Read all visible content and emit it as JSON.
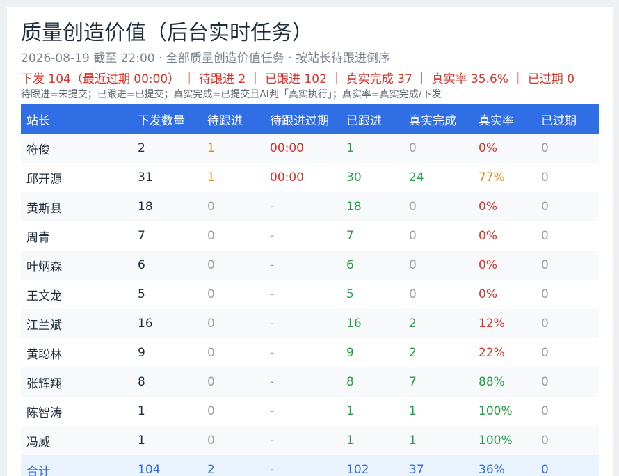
{
  "header": {
    "title": "质量创造价值（后台实时任务）",
    "subtitle": "2026-08-19 截至 22:00 · 全部质量创造价值任务 · 按站长待跟进倒序",
    "summary": "下发 104（最近过期 00:00） ｜ 待跟进 2 ｜ 已跟进 102 ｜ 真实完成 37 ｜ 真实率 35.6% ｜ 已过期 0",
    "note": "待跟进=未提交；已跟进=已提交；真实完成=已提交且AI判「真实执行」；真实率=真实完成/下发"
  },
  "table": {
    "columns": [
      "站长",
      "下发数量",
      "待跟进",
      "待跟进过期",
      "已跟进",
      "真实完成",
      "真实率",
      "已过期"
    ],
    "rows": [
      {
        "name": "符俊",
        "issued": "2",
        "pending": "1",
        "pending_expire": "00:00",
        "followed": "1",
        "real_done": "0",
        "real_rate": "0%",
        "expired": "0"
      },
      {
        "name": "邱开源",
        "issued": "31",
        "pending": "1",
        "pending_expire": "00:00",
        "followed": "30",
        "real_done": "24",
        "real_rate": "77%",
        "expired": "0"
      },
      {
        "name": "黄斯县",
        "issued": "18",
        "pending": "0",
        "pending_expire": "-",
        "followed": "18",
        "real_done": "0",
        "real_rate": "0%",
        "expired": "0"
      },
      {
        "name": "周青",
        "issued": "7",
        "pending": "0",
        "pending_expire": "-",
        "followed": "7",
        "real_done": "0",
        "real_rate": "0%",
        "expired": "0"
      },
      {
        "name": "叶炳森",
        "issued": "6",
        "pending": "0",
        "pending_expire": "-",
        "followed": "6",
        "real_done": "0",
        "real_rate": "0%",
        "expired": "0"
      },
      {
        "name": "王文龙",
        "issued": "5",
        "pending": "0",
        "pending_expire": "-",
        "followed": "5",
        "real_done": "0",
        "real_rate": "0%",
        "expired": "0"
      },
      {
        "name": "江兰斌",
        "issued": "16",
        "pending": "0",
        "pending_expire": "-",
        "followed": "16",
        "real_done": "2",
        "real_rate": "12%",
        "expired": "0"
      },
      {
        "name": "黄聪林",
        "issued": "9",
        "pending": "0",
        "pending_expire": "-",
        "followed": "9",
        "real_done": "2",
        "real_rate": "22%",
        "expired": "0"
      },
      {
        "name": "张辉翔",
        "issued": "8",
        "pending": "0",
        "pending_expire": "-",
        "followed": "8",
        "real_done": "7",
        "real_rate": "88%",
        "expired": "0"
      },
      {
        "name": "陈智涛",
        "issued": "1",
        "pending": "0",
        "pending_expire": "-",
        "followed": "1",
        "real_done": "1",
        "real_rate": "100%",
        "expired": "0"
      },
      {
        "name": "冯威",
        "issued": "1",
        "pending": "0",
        "pending_expire": "-",
        "followed": "1",
        "real_done": "1",
        "real_rate": "100%",
        "expired": "0"
      }
    ],
    "total": {
      "name": "合计",
      "issued": "104",
      "pending": "2",
      "pending_expire": "-",
      "followed": "102",
      "real_done": "37",
      "real_rate": "36%",
      "expired": "0"
    }
  },
  "colors": {
    "header_bg": "#2f6ee5",
    "danger": "#d9342b",
    "warning": "#d98a1e",
    "success": "#23a047",
    "muted": "#9aa1a8"
  }
}
